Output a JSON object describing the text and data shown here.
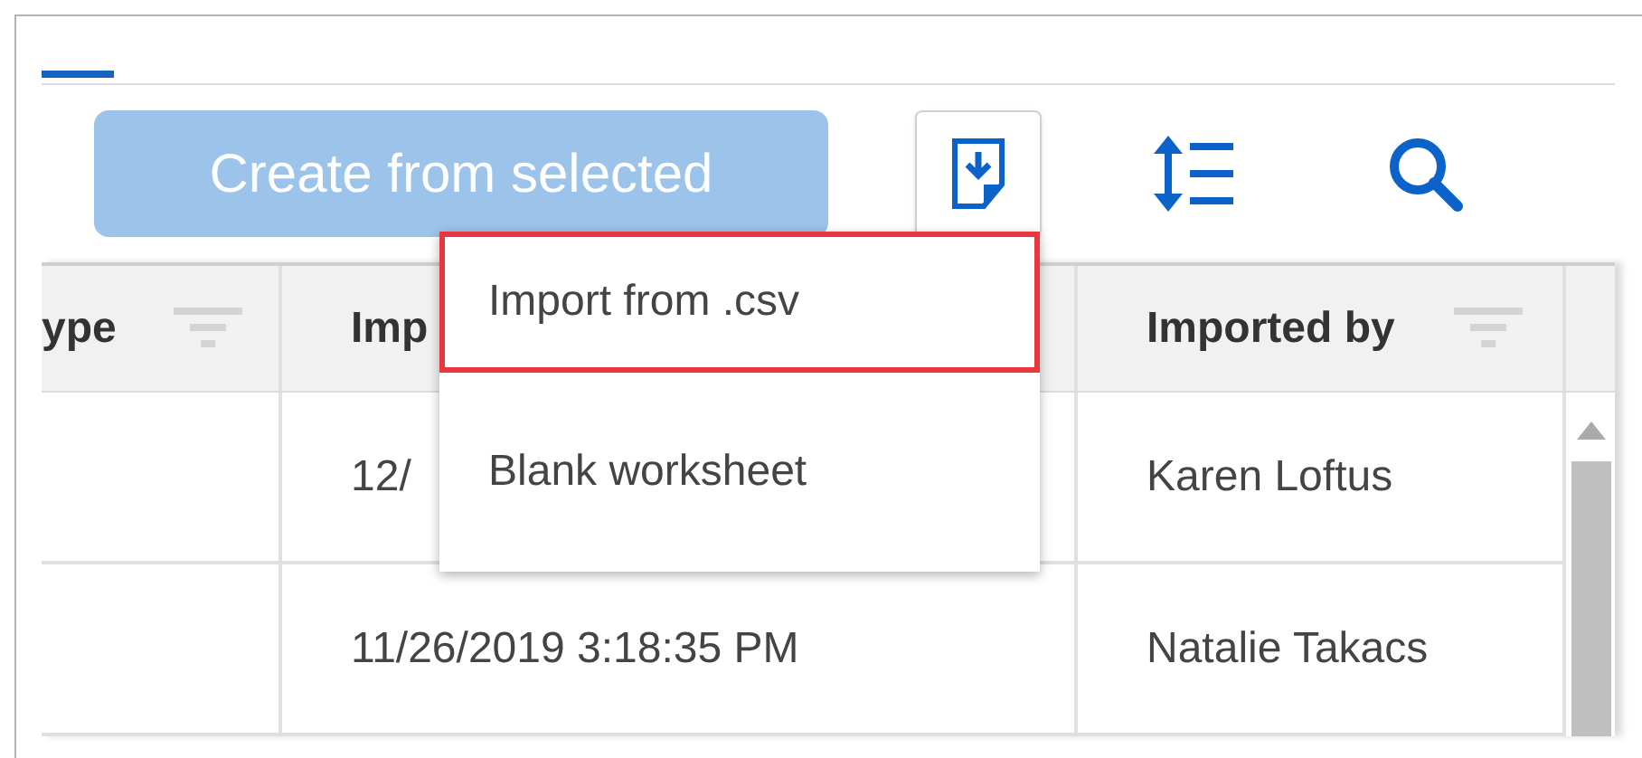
{
  "toolbar": {
    "create_button": {
      "label": "Create from selected",
      "disabled": true
    }
  },
  "menu": {
    "items": [
      {
        "label": "Import from .csv",
        "highlighted": true
      },
      {
        "label": "Blank worksheet",
        "highlighted": false
      }
    ]
  },
  "table": {
    "columns": [
      "ype",
      "Imp",
      "Imported by"
    ],
    "rows": [
      [
        "",
        "12/",
        "Karen Loftus"
      ],
      [
        "",
        "11/26/2019 3:18:35 PM",
        "Natalie Takacs"
      ]
    ]
  }
}
